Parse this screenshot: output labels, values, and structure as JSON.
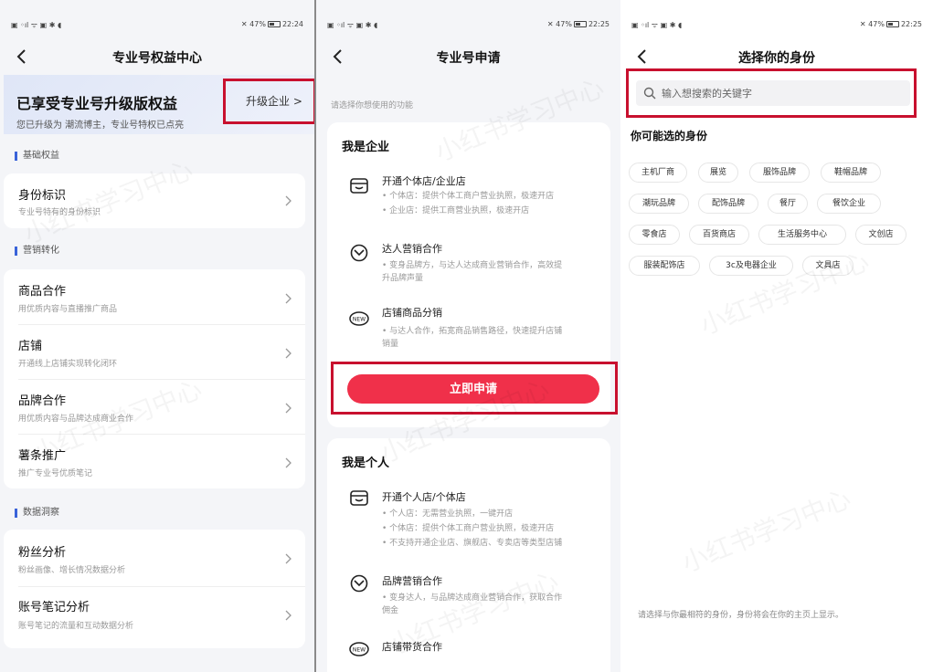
{
  "p1": {
    "status": {
      "left": "▣ ◦ıl ᯤ ▣ ✱ ◖",
      "battery": "47%",
      "time": "22:24"
    },
    "title": "专业号权益中心",
    "hero_title": "已享受专业号升级版权益",
    "hero_sub": "您已升级为 潮流博主，专业号特权已点亮",
    "upgrade_label": "升级企业 >",
    "sections": [
      {
        "label": "基础权益"
      },
      {
        "label": "营销转化"
      },
      {
        "label": "数据洞察"
      }
    ],
    "rows": [
      {
        "title": "身份标识",
        "desc": "专业号特有的身份标识"
      },
      {
        "title": "商品合作",
        "desc": "用优质内容与直播推广商品"
      },
      {
        "title": "店铺",
        "desc": "开通线上店铺实现转化闭环"
      },
      {
        "title": "品牌合作",
        "desc": "用优质内容与品牌达成商业合作"
      },
      {
        "title": "薯条推广",
        "desc": "推广专业号优质笔记"
      },
      {
        "title": "粉丝分析",
        "desc": "粉丝画像、增长情况数据分析"
      },
      {
        "title": "账号笔记分析",
        "desc": "账号笔记的流量和互动数据分析"
      }
    ]
  },
  "p2": {
    "status": {
      "left": "▣ ◦ıl ᯤ ▣ ✱ ◖",
      "battery": "47%",
      "time": "22:25"
    },
    "title": "专业号申请",
    "hint": "请选择你想使用的功能",
    "enterprise": {
      "title": "我是企业",
      "features": [
        {
          "title": "开通个体店/企业店",
          "lines": [
            "• 个体店：提供个体工商户营业执照，极速开店",
            "• 企业店：提供工商营业执照，极速开店"
          ]
        },
        {
          "title": "达人营销合作",
          "lines": [
            "• 变身品牌方，与达人达成商业营销合作，高效提",
            "升品牌声量"
          ]
        },
        {
          "title": "店铺商品分销",
          "lines": [
            "• 与达人合作，拓宽商品销售路径，快速提升店铺",
            "销量"
          ]
        }
      ],
      "apply_label": "立即申请"
    },
    "personal": {
      "title": "我是个人",
      "features": [
        {
          "title": "开通个人店/个体店",
          "lines": [
            "• 个人店：无需营业执照，一键开店",
            "• 个体店：提供个体工商户营业执照，极速开店",
            "• 不支持开通企业店、旗舰店、专卖店等类型店铺"
          ]
        },
        {
          "title": "品牌营销合作",
          "lines": [
            "• 变身达人，与品牌达成商业营销合作，获取合作",
            "佣金"
          ]
        },
        {
          "title": "店铺带货合作",
          "lines": []
        }
      ]
    }
  },
  "p3": {
    "status": {
      "left": "▣ ◦ıl ᯤ ▣ ✱ ◖",
      "battery": "47%",
      "time": "22:25"
    },
    "title": "选择你的身份",
    "search_placeholder": "输入想搜索的关键字",
    "heading": "你可能选的身份",
    "chips": [
      "主机厂商",
      "展览",
      "服饰品牌",
      "鞋帽品牌",
      "潮玩品牌",
      "配饰品牌",
      "餐厅",
      "餐饮企业",
      "零食店",
      "百货商店",
      "生活服务中心",
      "文创店",
      "服装配饰店",
      "3c及电器企业",
      "文具店"
    ],
    "footer": "请选择与你最相符的身份，身份将会在你的主页上显示。"
  },
  "watermark": "小红书学习中心",
  "colors": {
    "accent": "#f0304a",
    "highlight": "#c8102e",
    "section_bar": "#3a63d9"
  }
}
